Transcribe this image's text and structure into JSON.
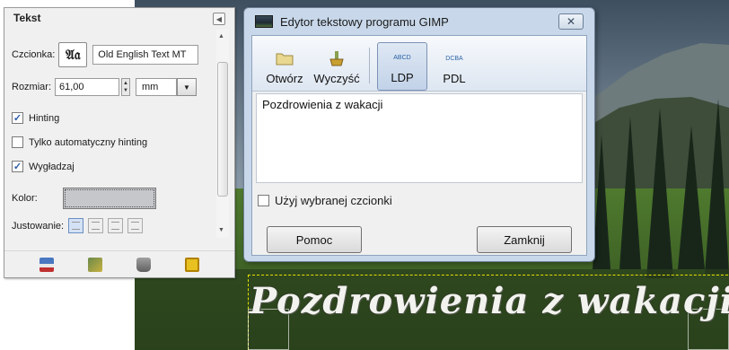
{
  "tool_options": {
    "title": "Tekst",
    "font_label": "Czcionka:",
    "font_preview": "𝔄𝔞",
    "font_value": "Old English Text MT",
    "size_label": "Rozmiar:",
    "size_value": "61,00",
    "unit_value": "mm",
    "hinting_label": "Hinting",
    "hinting_checked": true,
    "auto_hinting_label": "Tylko automatyczny hinting",
    "auto_hinting_checked": false,
    "smoothing_label": "Wygładzaj",
    "smoothing_checked": true,
    "color_label": "Kolor:",
    "color_value": "#c6c7cb",
    "justify_label": "Justowanie:"
  },
  "editor": {
    "title": "Edytor tekstowy programu GIMP",
    "toolbar": {
      "open_label": "Otwórz",
      "clear_label": "Wyczyść",
      "ltr_label": "LDP",
      "rtl_label": "PDL",
      "ltr_icon_text": "ABCD",
      "rtl_icon_text": "DCBA"
    },
    "text_content": "Pozdrowienia z wakacji",
    "use_font_label": "Użyj wybranej czcionki",
    "use_font_checked": false,
    "help_label": "Pomoc",
    "close_label": "Zamknij"
  },
  "canvas": {
    "text_layer": "Pozdrowienia z wakacji"
  },
  "colors": {
    "dialog_frame": "#c8d8ea",
    "accent_checked": "#2b5aa8",
    "selection": "#e8e000"
  }
}
